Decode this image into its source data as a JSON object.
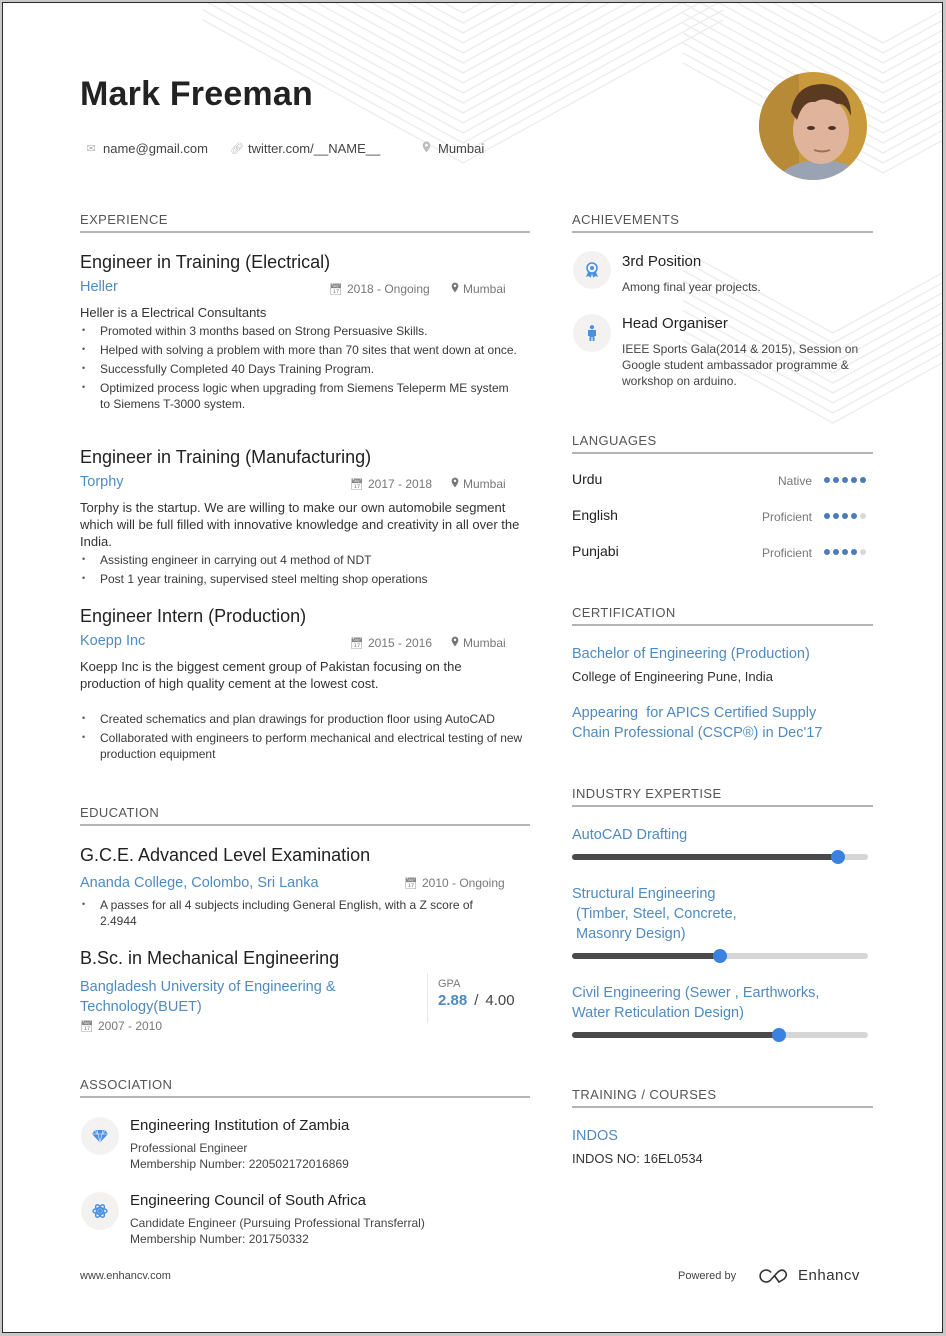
{
  "header": {
    "name": "Mark Freeman",
    "contacts": [
      {
        "icon": "at-icon",
        "text": "name@gmail.com"
      },
      {
        "icon": "link-icon",
        "text": "twitter.com/__NAME__"
      },
      {
        "icon": "location-pin-icon",
        "text": "Mumbai"
      }
    ],
    "photo_alt": "profile photo"
  },
  "experience": {
    "title": "EXPERIENCE",
    "jobs": [
      {
        "title": "Engineer in Training (Electrical)",
        "company": "Heller",
        "dates": "2018 - Ongoing",
        "location": "Mumbai",
        "description": "Heller is a Electrical Consultants",
        "bullets": [
          "Promoted within 3 months based on Strong Persuasive Skills.",
          "Helped with solving a problem with more than 70 sites that went down at once.",
          "Successfully Completed 40 Days Training Program.",
          "Optimized process logic when upgrading from Siemens Teleperm ME system to Siemens T-3000 system."
        ]
      },
      {
        "title": "Engineer in Training (Manufacturing)",
        "company": "Torphy",
        "dates": "2017 - 2018",
        "location": "Mumbai",
        "description": "Torphy is the startup. We are willing to make our own automobile segment which will be full filled with innovative knowledge and creativity in all over the India.",
        "bullets": [
          "Assisting engineer in carrying out 4 method of NDT",
          "Post 1 year training, supervised steel melting shop operations"
        ]
      },
      {
        "title": "Engineer Intern (Production)",
        "company": "Koepp Inc",
        "dates": "2015 - 2016",
        "location": "Mumbai",
        "description": "Koepp Inc is the biggest cement group of Pakistan focusing on the production of high quality cement at the lowest cost.",
        "bullets": [
          "Created schematics and plan drawings for production floor using AutoCAD",
          "Collaborated with engineers to perform mechanical and electrical testing of new production equipment"
        ]
      }
    ]
  },
  "education": {
    "title": "EDUCATION",
    "items": [
      {
        "degree": "G.C.E. Advanced Level Examination",
        "school": "Ananda College, Colombo, Sri Lanka",
        "dates": "2010 - Ongoing",
        "bullets": [
          "A passes for all 4 subjects including General English, with a Z score of 2.4944"
        ]
      },
      {
        "degree": "B.Sc. in Mechanical Engineering",
        "school": "Bangladesh University of Engineering & Technology(BUET)",
        "dates": "2007 - 2010",
        "gpa_label": "GPA",
        "gpa": "2.88",
        "gpa_sep": "/",
        "gpa_max": "4.00"
      }
    ]
  },
  "association": {
    "title": "ASSOCIATION",
    "items": [
      {
        "icon": "diamond-icon",
        "name": "Engineering Institution of Zambia",
        "role": "Professional Engineer",
        "membership": "Membership Number: 220502172016869"
      },
      {
        "icon": "atom-icon",
        "name": "Engineering Council of South Africa",
        "role": "Candidate Engineer (Pursuing Professional Transferral)",
        "membership": "Membership Number: 201750332"
      }
    ]
  },
  "achievements": {
    "title": "ACHIEVEMENTS",
    "items": [
      {
        "icon": "award-ribbon-icon",
        "title": "3rd Position",
        "desc": "Among final year projects."
      },
      {
        "icon": "person-icon",
        "title": "Head Organiser",
        "desc": "IEEE Sports Gala(2014 & 2015), Session on Google student ambassador programme & workshop on arduino."
      }
    ]
  },
  "languages": {
    "title": "LANGUAGES",
    "items": [
      {
        "name": "Urdu",
        "level": "Native",
        "rating": 5,
        "max": 5
      },
      {
        "name": "English",
        "level": "Proficient",
        "rating": 4,
        "max": 5
      },
      {
        "name": "Punjabi",
        "level": "Proficient",
        "rating": 4,
        "max": 5
      }
    ]
  },
  "certification": {
    "title": "CERTIFICATION",
    "items": [
      {
        "title": "Bachelor of Engineering (Production)",
        "sub": "College of Engineering Pune, India"
      },
      {
        "title": "Appearing  for APICS Certified Supply Chain Professional (CSCP®) in Dec'17",
        "sub": ""
      }
    ]
  },
  "expertise": {
    "title": "INDUSTRY EXPERTISE",
    "items": [
      {
        "label": "AutoCAD Drafting",
        "level": 0.9
      },
      {
        "label": "Structural Engineering\n (Timber, Steel, Concrete,\n Masonry Design)",
        "level": 0.5
      },
      {
        "label": "Civil Engineering (Sewer , Earthworks,\nWater Reticulation Design)",
        "level": 0.7
      }
    ]
  },
  "training": {
    "title": "TRAINING / COURSES",
    "items": [
      {
        "title": "INDOS",
        "sub": "INDOS NO: 16EL0534"
      }
    ]
  },
  "footer": {
    "website": "www.enhancv.com",
    "powered_by": "Powered by",
    "brand": "Enhancv"
  },
  "colors": {
    "accent": "#4f8ac0",
    "slider_knob": "#3b82e0",
    "slider_fill": "#4a4a4a",
    "dot_on": "#4b7bb8",
    "dot_off": "#d8d8d8"
  }
}
